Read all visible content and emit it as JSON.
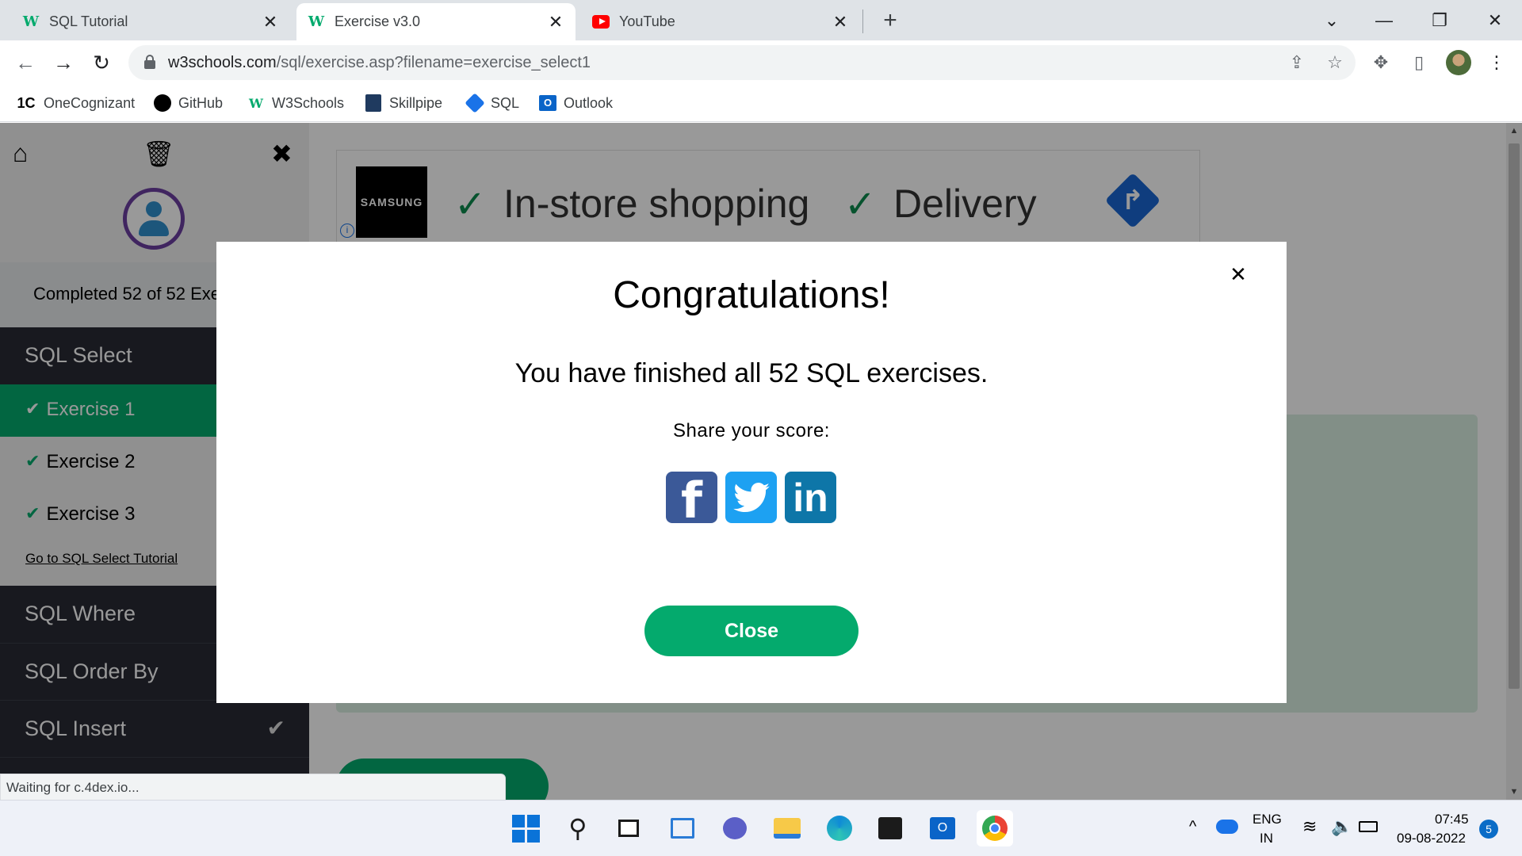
{
  "tabs": [
    {
      "label": "SQL Tutorial",
      "icon": "w3schools-icon",
      "active": false
    },
    {
      "label": "Exercise v3.0",
      "icon": "w3schools-icon",
      "active": true
    },
    {
      "label": "YouTube",
      "icon": "youtube-icon",
      "active": false
    }
  ],
  "address": {
    "domain": "w3schools.com",
    "path": "/sql/exercise.asp?filename=exercise_select1"
  },
  "bookmarks": [
    {
      "label": "OneCognizant",
      "icon": "1C"
    },
    {
      "label": "GitHub",
      "icon": "github-icon"
    },
    {
      "label": "W3Schools",
      "icon": "w3schools-icon"
    },
    {
      "label": "Skillpipe",
      "icon": "skillpipe-icon"
    },
    {
      "label": "SQL",
      "icon": "sql-icon"
    },
    {
      "label": "Outlook",
      "icon": "outlook-icon"
    }
  ],
  "sidebar": {
    "progress_text": "Completed 52 of 52 Exercises",
    "sections": [
      {
        "label": "SQL Select"
      },
      {
        "label": "SQL Where"
      },
      {
        "label": "SQL Order By"
      },
      {
        "label": "SQL Insert"
      }
    ],
    "exercises": [
      {
        "label": "Exercise 1",
        "done": true
      },
      {
        "label": "Exercise 2",
        "done": true
      },
      {
        "label": "Exercise 3",
        "done": true
      }
    ],
    "tutorial_link": "Go to SQL Select Tutorial"
  },
  "ad": {
    "brand": "SAMSUNG",
    "item1": "In-store shopping",
    "item2": "Delivery"
  },
  "status_text": "Waiting for c.4dex.io...",
  "modal": {
    "title": "Congratulations!",
    "message": "You have finished all 52 SQL exercises.",
    "share_label": "Share your score:",
    "close_button": "Close"
  },
  "tray": {
    "lang_top": "ENG",
    "lang_bottom": "IN",
    "time": "07:45",
    "date": "09-08-2022",
    "notifications": "5"
  },
  "colors": {
    "accent": "#04aa6d",
    "sidebar_dark": "#282a35",
    "facebook": "#3b5998",
    "twitter": "#1da1f2",
    "linkedin": "#0e76a8"
  }
}
